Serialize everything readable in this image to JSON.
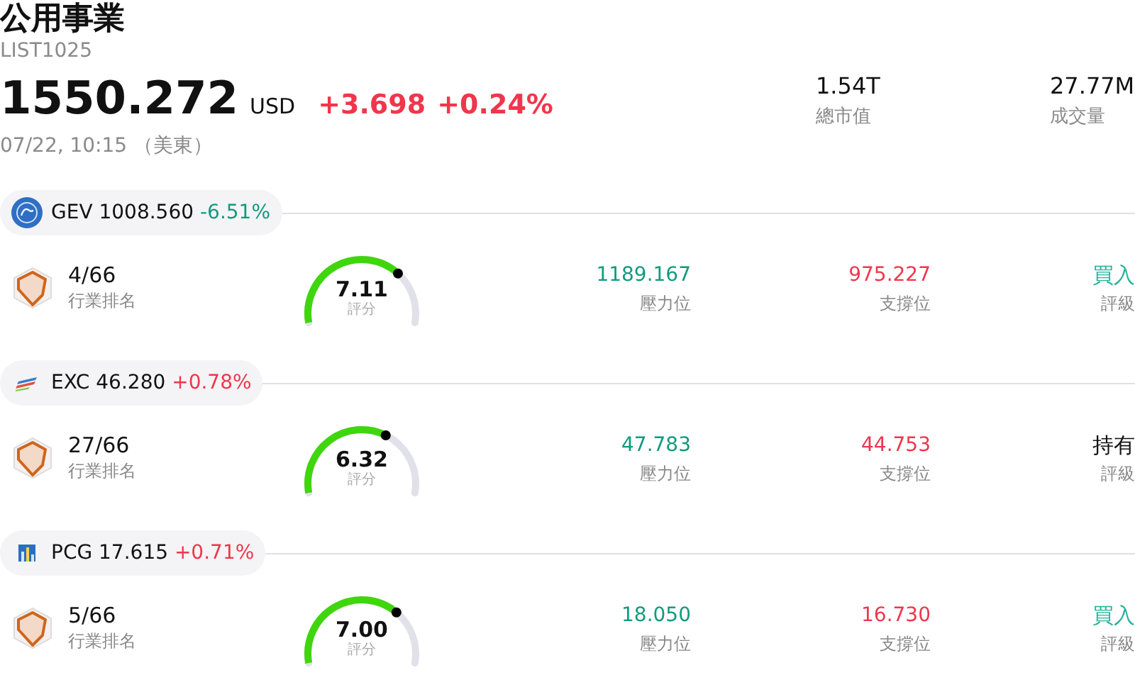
{
  "header": {
    "title": "公用事業",
    "code": "LIST1025",
    "price": "1550.272",
    "currency": "USD",
    "change": "+3.698",
    "change_pct": "+0.24%",
    "color": "#f0364c",
    "time": "07/22, 10:15 （美東）"
  },
  "stats": [
    {
      "value": "1.54T",
      "label": "總市值"
    },
    {
      "value": "27.77M",
      "label": "成交量"
    }
  ],
  "stocks": [
    {
      "ticker": "GEV",
      "price": "1008.560",
      "change": "-6.51%",
      "color": "#119a7f",
      "rank": "4/66",
      "rank_label": "行業排名",
      "gauge": {
        "score": "7.11",
        "label": "評分"
      },
      "resistance": "1189.167",
      "resistance_label": "壓力位",
      "support": "975.227",
      "support_label": "支撐位",
      "rating": {
        "value": "買入",
        "color": "#27b39b",
        "label": "評級"
      }
    },
    {
      "ticker": "EXC",
      "price": "46.280",
      "change": "+0.78%",
      "color": "#f0364c",
      "rank": "27/66",
      "rank_label": "行業排名",
      "gauge": {
        "score": "6.32",
        "label": "評分"
      },
      "resistance": "47.783",
      "resistance_label": "壓力位",
      "support": "44.753",
      "support_label": "支撐位",
      "rating": {
        "value": "持有",
        "color": "#111111",
        "label": "評級"
      }
    },
    {
      "ticker": "PCG",
      "price": "17.615",
      "change": "+0.71%",
      "color": "#f0364c",
      "rank": "5/66",
      "rank_label": "行業排名",
      "gauge": {
        "score": "7.00",
        "label": "評分"
      },
      "resistance": "18.050",
      "resistance_label": "壓力位",
      "support": "16.730",
      "support_label": "支撐位",
      "rating": {
        "value": "買入",
        "color": "#27b39b",
        "label": "評級"
      }
    }
  ]
}
